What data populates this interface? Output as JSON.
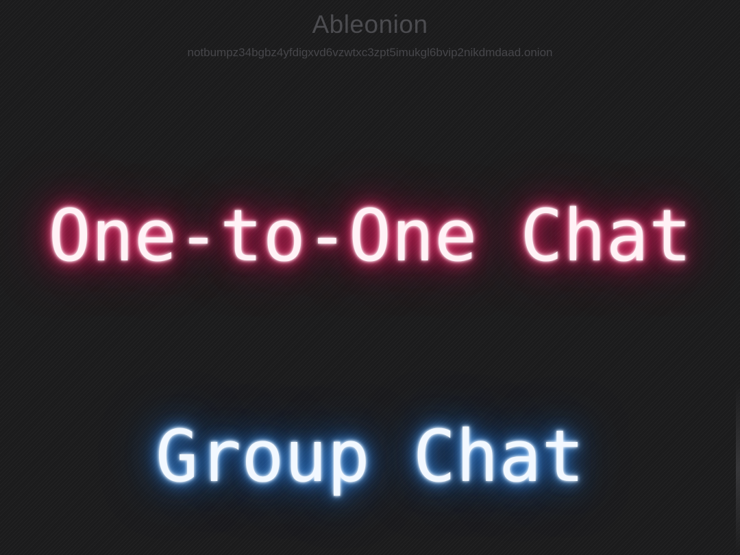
{
  "header": {
    "title": "Ableonion",
    "address": "notbumpz34bgbz4yfdigxvd6vzwtxc3zpt5imukgl6bvip2nikdmdaad.onion"
  },
  "menu": {
    "one_to_one_label": "One-to-One Chat",
    "group_label": "Group Chat"
  },
  "colors": {
    "background": "#1b1b1c",
    "one_to_one_glow": "#ff2d6e",
    "group_glow": "#3d9bff"
  }
}
